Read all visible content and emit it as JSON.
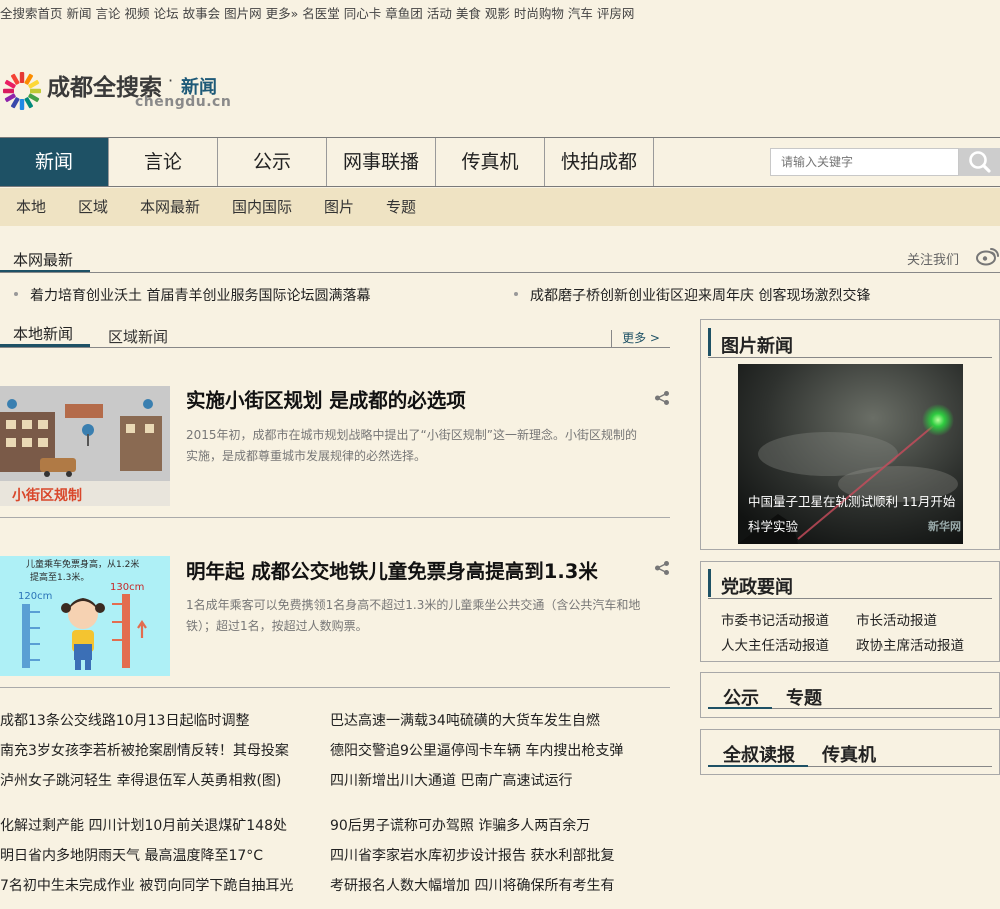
{
  "top_links": [
    "全搜索首页",
    "新闻",
    "言论",
    "视频",
    "论坛",
    "故事会",
    "图片网",
    "更多»",
    "名医堂",
    "同心卡",
    "章鱼团",
    "活动",
    "美食",
    "观影",
    "时尚购物",
    "汽车",
    "评房网"
  ],
  "logo": {
    "title": "成都全搜索",
    "dot": "·",
    "section": "新闻",
    "domain": "chengdu.cn"
  },
  "main_nav": [
    {
      "label": "新闻",
      "active": true
    },
    {
      "label": "言论"
    },
    {
      "label": "公示"
    },
    {
      "label": "网事联播"
    },
    {
      "label": "传真机"
    },
    {
      "label": "快拍成都"
    }
  ],
  "search": {
    "placeholder": "请输入关键字"
  },
  "sub_nav": [
    "本地",
    "区域",
    "本网最新",
    "国内国际",
    "图片",
    "专题"
  ],
  "latest": {
    "title": "本网最新",
    "follow": "关注我们",
    "items": [
      "着力培育创业沃土 首届青羊创业服务国际论坛圆满落幕",
      "成都磨子桥创新创业街区迎来周年庆 创客现场激烈交锋"
    ]
  },
  "local_tabs": {
    "tab1": "本地新闻",
    "tab2": "区域新闻",
    "more": "更多 >"
  },
  "features": [
    {
      "title": "实施小街区规划 是成都的必选项",
      "summary": "2015年初，成都市在城市规划战略中提出了“小街区规制”这一新理念。小街区规制的实施，是成都尊重城市发展规律的必然选择。",
      "thumb_text": "小街区规制"
    },
    {
      "title": "明年起 成都公交地铁儿童免票身高提高到1.3米",
      "summary": "1名成年乘客可以免费携领1名身高不超过1.3米的儿童乘坐公共交通（含公共汽车和地铁）；超过1名，按超过人数购票。",
      "thumb_text_1": "儿童乘车免票身高，从1.2米",
      "thumb_text_2": "提高至1.3米。",
      "thumb_left": "120cm",
      "thumb_right": "130cm"
    }
  ],
  "headlines": {
    "group1": [
      [
        "成都13条公交线路10月13日起临时调整",
        "巴达高速一满载34吨硫磺的大货车发生自燃"
      ],
      [
        "南充3岁女孩李若析被抢案剧情反转！其母投案",
        "德阳交警追9公里逼停闯卡车辆 车内搜出枪支弹"
      ],
      [
        "泸州女子跳河轻生 幸得退伍军人英勇相救(图)",
        "四川新增出川大通道 巴南广高速试运行"
      ]
    ],
    "group2": [
      [
        "化解过剩产能 四川计划10月前关退煤矿148处",
        "90后男子谎称可办驾照 诈骗多人两百余万"
      ],
      [
        "明日省内多地阴雨天气 最高温度降至17°C",
        "四川省李家岩水库初步设计报告 获水利部批复"
      ],
      [
        "7名初中生未完成作业 被罚向同学下跪自抽耳光",
        "考研报名人数大幅增加 四川将确保所有考生有"
      ]
    ]
  },
  "photo_news": {
    "title": "图片新闻",
    "caption": "中国量子卫星在轨测试顺利 11月开始科学实验",
    "watermark": "新华网"
  },
  "party_news": {
    "title": "党政要闻",
    "links": [
      "市委书记活动报道",
      "市长活动报道",
      "人大主任活动报道",
      "政协主席活动报道"
    ]
  },
  "box_tabs_1": [
    "公示",
    "专题"
  ],
  "box_tabs_2": [
    "全叔读报",
    "传真机"
  ],
  "colors": {
    "accent": "#1e5165",
    "background": "#f8f2e2",
    "subnav": "#efe3c3"
  }
}
